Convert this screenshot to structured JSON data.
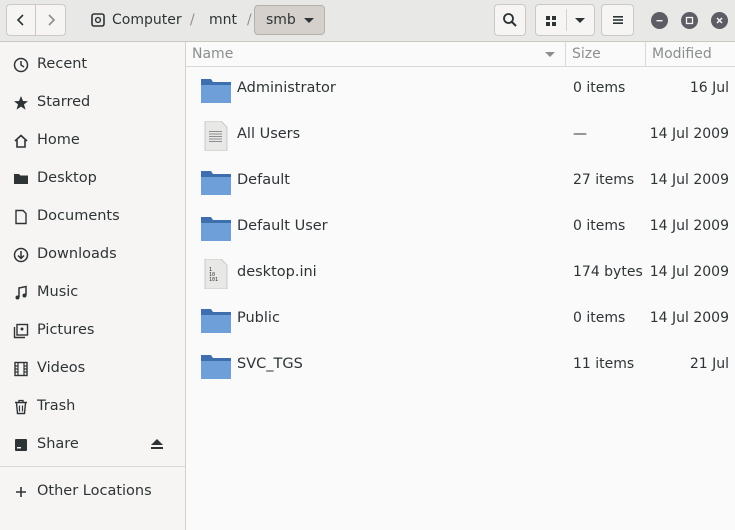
{
  "toolbar": {
    "breadcrumbs": [
      "Computer",
      "mnt",
      "smb"
    ],
    "separator": "/"
  },
  "sidebar": {
    "items": [
      {
        "label": "Recent",
        "icon": "clock-icon"
      },
      {
        "label": "Starred",
        "icon": "star-icon"
      },
      {
        "label": "Home",
        "icon": "home-icon"
      },
      {
        "label": "Desktop",
        "icon": "folder-icon"
      },
      {
        "label": "Documents",
        "icon": "document-icon"
      },
      {
        "label": "Downloads",
        "icon": "download-icon"
      },
      {
        "label": "Music",
        "icon": "music-icon"
      },
      {
        "label": "Pictures",
        "icon": "pictures-icon"
      },
      {
        "label": "Videos",
        "icon": "video-icon"
      },
      {
        "label": "Trash",
        "icon": "trash-icon"
      },
      {
        "label": "Share",
        "icon": "drive-icon"
      },
      {
        "label": "Other Locations",
        "icon": "plus-icon"
      }
    ]
  },
  "list": {
    "columns": {
      "name": "Name",
      "size": "Size",
      "modified": "Modified"
    },
    "rows": [
      {
        "name": "Administrator",
        "type": "folder",
        "size": "0 items",
        "modified": "16 Jul"
      },
      {
        "name": "All Users",
        "type": "text-file",
        "size": "—",
        "modified": "14 Jul 2009"
      },
      {
        "name": "Default",
        "type": "folder",
        "size": "27 items",
        "modified": "14 Jul 2009"
      },
      {
        "name": "Default User",
        "type": "folder",
        "size": "0 items",
        "modified": "14 Jul 2009"
      },
      {
        "name": "desktop.ini",
        "type": "binary-file",
        "size": "174 bytes",
        "modified": "14 Jul 2009"
      },
      {
        "name": "Public",
        "type": "folder",
        "size": "0 items",
        "modified": "14 Jul 2009"
      },
      {
        "name": "SVC_TGS",
        "type": "folder",
        "size": "11 items",
        "modified": "21 Jul"
      }
    ]
  },
  "colors": {
    "folder": "#6f9fd8",
    "folder_dark": "#3d6fae",
    "window_control": "#5e5c64"
  }
}
